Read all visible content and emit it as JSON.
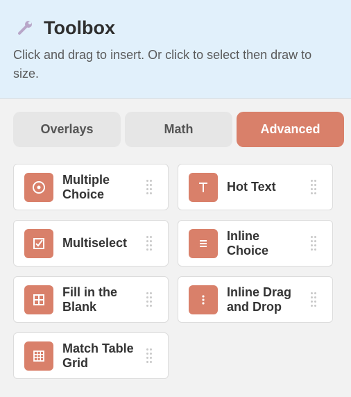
{
  "header": {
    "title": "Toolbox",
    "description": "Click and drag to insert. Or click to select then draw to size.",
    "icon": "wrench-icon"
  },
  "tabs": [
    {
      "label": "Overlays",
      "active": false
    },
    {
      "label": "Math",
      "active": false
    },
    {
      "label": "Advanced",
      "active": true
    }
  ],
  "items": [
    {
      "label": "Multiple Choice",
      "icon": "radio-icon"
    },
    {
      "label": "Hot Text",
      "icon": "text-t-icon"
    },
    {
      "label": "Multiselect",
      "icon": "checkbox-icon"
    },
    {
      "label": "Inline Choice",
      "icon": "list-icon"
    },
    {
      "label": "Fill in the Blank",
      "icon": "grid-box-icon"
    },
    {
      "label": "Inline Drag and Drop",
      "icon": "vertical-dots-icon"
    },
    {
      "label": "Match Table Grid",
      "icon": "table-grid-icon"
    }
  ],
  "colors": {
    "accent": "#d9806a",
    "header_bg": "#e1f0fb",
    "panel_bg": "#f2f2f2"
  }
}
